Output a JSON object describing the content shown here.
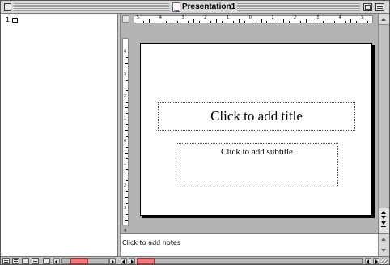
{
  "window": {
    "title": "Presentation1"
  },
  "outline": {
    "slide_number": "1"
  },
  "slide": {
    "title_placeholder": "Click to add title",
    "subtitle_placeholder": "Click to add subtitle"
  },
  "notes": {
    "placeholder": "Click to add notes"
  },
  "rulers": {
    "horizontal": [
      "5",
      "4",
      "3",
      "2",
      "1",
      "0",
      "1",
      "2",
      "3",
      "4",
      "5"
    ],
    "vertical": [
      "4",
      "3",
      "2",
      "1",
      "0",
      "1",
      "2",
      "3",
      "4"
    ]
  },
  "colors": {
    "scroll_thumb": "#f07878"
  }
}
